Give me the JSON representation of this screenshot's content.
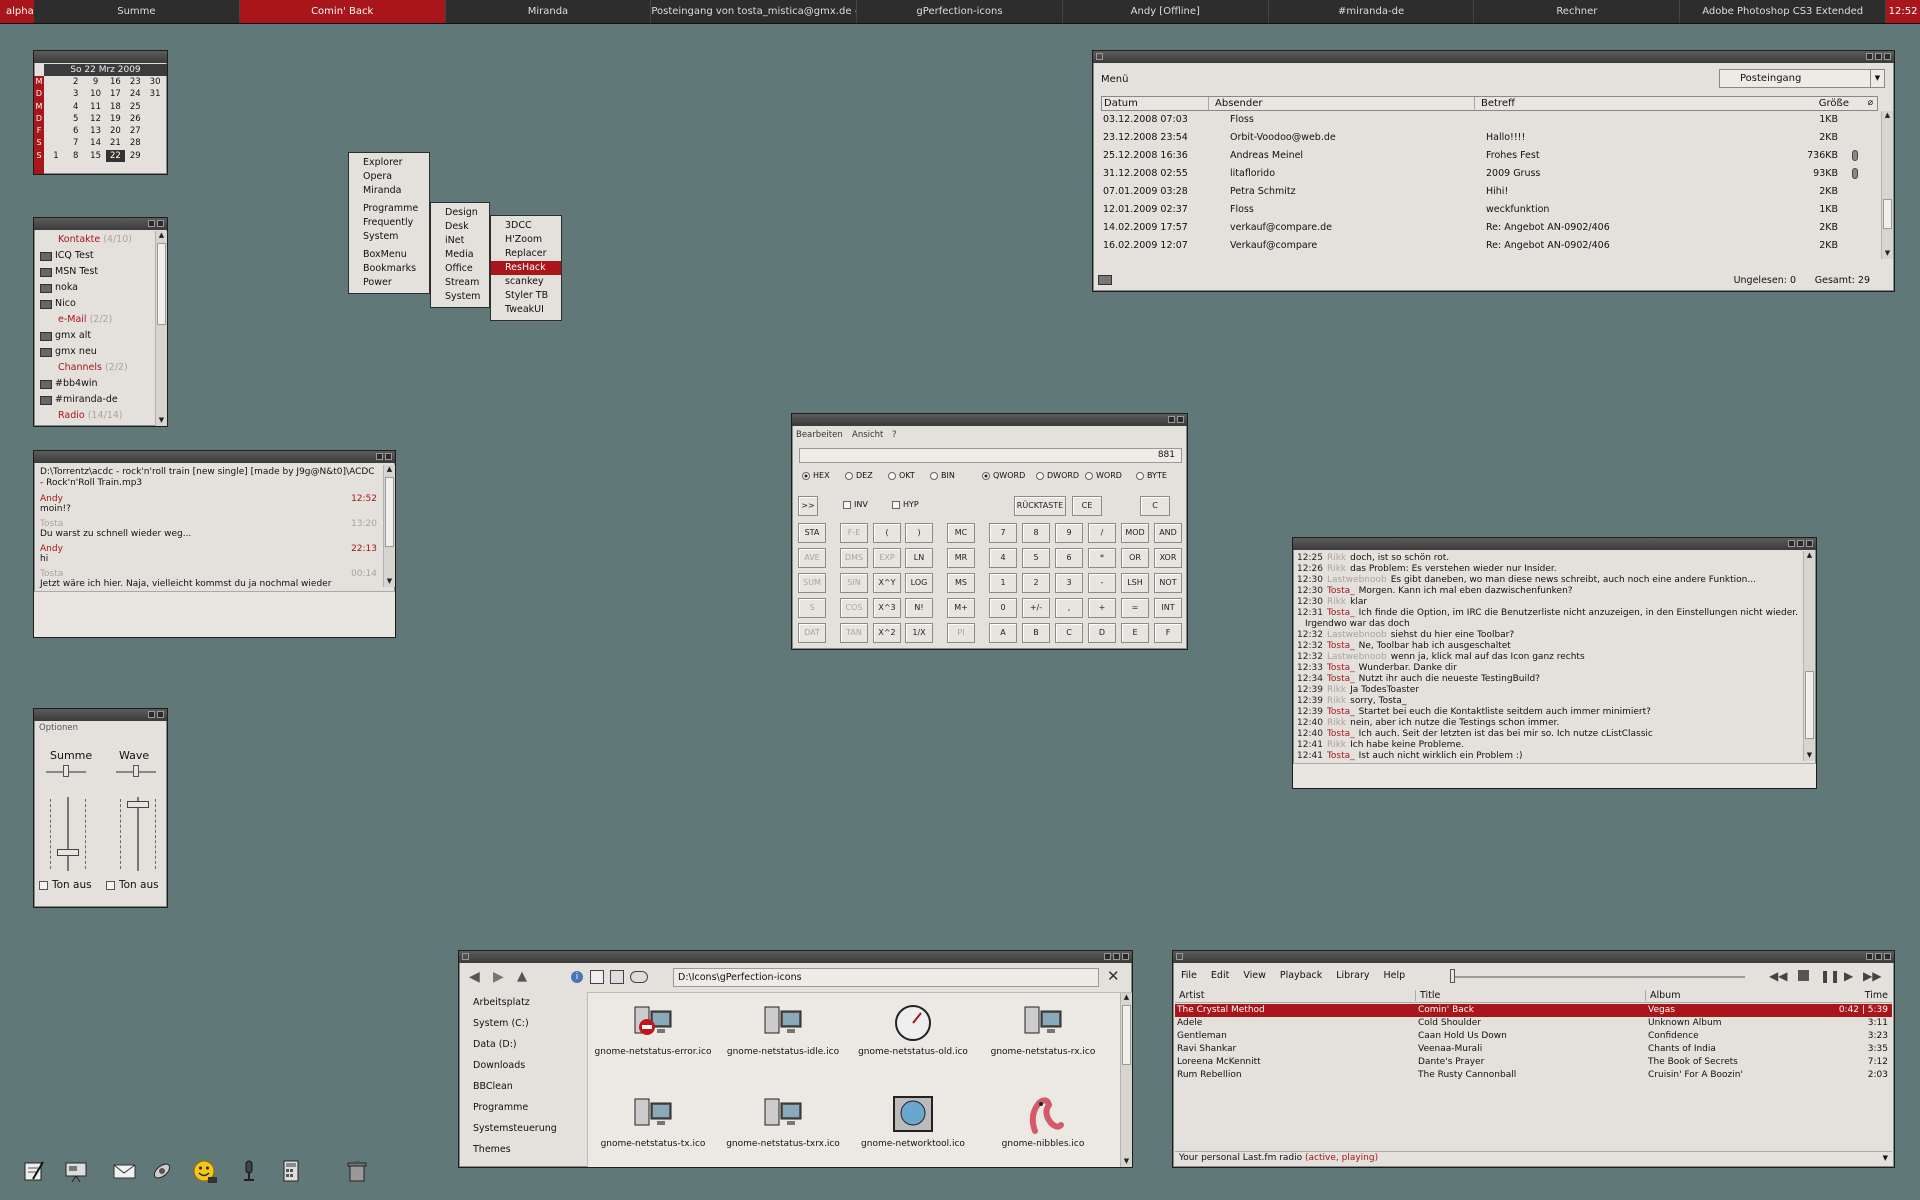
{
  "taskbar": {
    "start": "alpha",
    "tasks": [
      "Summe",
      "Comin' Back",
      "Miranda",
      "Posteingang von tosta_mistica@gmx.de - Thu...",
      "gPerfection-icons",
      "Andy [Offline]",
      "#miranda-de",
      "Rechner",
      "Adobe Photoshop CS3 Extended"
    ],
    "clock": "12:52"
  },
  "calendar": {
    "header": "So 22 Mrz 2009",
    "day_letters": [
      "M",
      "D",
      "M",
      "D",
      "F",
      "S",
      "S"
    ],
    "rows": [
      [
        "",
        "2",
        "9",
        "16",
        "23",
        "30"
      ],
      [
        "",
        "3",
        "10",
        "17",
        "24",
        "31"
      ],
      [
        "",
        "4",
        "11",
        "18",
        "25",
        ""
      ],
      [
        "",
        "5",
        "12",
        "19",
        "26",
        ""
      ],
      [
        "",
        "6",
        "13",
        "20",
        "27",
        ""
      ],
      [
        "",
        "7",
        "14",
        "21",
        "28",
        ""
      ],
      [
        "1",
        "8",
        "15",
        "22",
        "29",
        ""
      ]
    ]
  },
  "contacts": [
    {
      "type": "group",
      "label": "Kontakte",
      "count": "(4/10)"
    },
    {
      "type": "contact",
      "label": "ICQ Test"
    },
    {
      "type": "contact",
      "label": "MSN Test"
    },
    {
      "type": "contact",
      "label": "noka"
    },
    {
      "type": "contact",
      "label": "Nico"
    },
    {
      "type": "group",
      "label": "e-Mail",
      "count": "(2/2)"
    },
    {
      "type": "contact",
      "label": "gmx alt"
    },
    {
      "type": "contact",
      "label": "gmx neu"
    },
    {
      "type": "group",
      "label": "Channels",
      "count": "(2/2)"
    },
    {
      "type": "contact",
      "label": "#bb4win"
    },
    {
      "type": "contact",
      "label": "#miranda-de"
    },
    {
      "type": "group",
      "label": "Radio",
      "count": "(14/14)"
    }
  ],
  "chatlog": {
    "header": "D:\\Torrentz\\acdc - rock'n'roll train [new single] [made by J9g@N&t0]\\ACDC - Rock'n'Roll Train.mp3",
    "entries": [
      {
        "nick": "Andy",
        "time": "12:52",
        "text": "moin!?",
        "style": "red"
      },
      {
        "nick": "Tosta",
        "time": "13:20",
        "text": "Du warst zu schnell wieder weg...",
        "style": "grey"
      },
      {
        "nick": "Andy",
        "time": "22:13",
        "text": "hi",
        "style": "red"
      },
      {
        "nick": "Tosta",
        "time": "00:14",
        "text": "Jetzt wäre ich hier. Naja, vielleicht kommst du ja nochmal wieder",
        "style": "grey"
      }
    ]
  },
  "mixer": {
    "menu": "Optionen",
    "chan1": "Summe",
    "chan2": "Wave",
    "mute1": "Ton aus",
    "mute2": "Ton aus"
  },
  "menus": {
    "main_top": [
      "Explorer",
      "Opera",
      "Miranda"
    ],
    "main_bottom1": [
      "Programme",
      "Frequently",
      "System"
    ],
    "main_bottom2": [
      "BoxMenu",
      "Bookmarks",
      "Power"
    ],
    "programme": [
      "Design",
      "Desk",
      "iNet",
      "Media",
      "Office",
      "Stream",
      "System"
    ],
    "design": [
      "3DCC",
      "H'Zoom",
      "Replacer",
      "ResHack",
      "scankey",
      "Styler TB",
      "TweakUI"
    ],
    "selected": "ResHack"
  },
  "email": {
    "menu_label": "Menü",
    "folder": "Posteingang",
    "columns": {
      "date": "Datum",
      "from": "Absender",
      "subject": "Betreff",
      "size": "Größe"
    },
    "rows": [
      {
        "date": "03.12.2008 07:03",
        "from": "Floss",
        "subject": "",
        "size": "1KB",
        "attach": false
      },
      {
        "date": "23.12.2008 23:54",
        "from": "Orbit-Voodoo@web.de",
        "subject": "Hallo!!!!",
        "size": "2KB",
        "attach": false
      },
      {
        "date": "25.12.2008 16:36",
        "from": "Andreas Meinel",
        "subject": "Frohes Fest",
        "size": "736KB",
        "attach": true
      },
      {
        "date": "31.12.2008 02:55",
        "from": "litaflorido",
        "subject": "2009 Gruss",
        "size": "93KB",
        "attach": true
      },
      {
        "date": "07.01.2009 03:28",
        "from": "Petra Schmitz",
        "subject": "Hihi!",
        "size": "2KB",
        "attach": false
      },
      {
        "date": "12.01.2009 02:37",
        "from": "Floss",
        "subject": "weckfunktion",
        "size": "1KB",
        "attach": false
      },
      {
        "date": "14.02.2009 17:57",
        "from": "verkauf@compare.de",
        "subject": "Re: Angebot AN-0902/406",
        "size": "2KB",
        "attach": false
      },
      {
        "date": "16.02.2009 12:07",
        "from": "Verkauf@compare",
        "subject": "Re: Angebot AN-0902/406",
        "size": "2KB",
        "attach": false
      }
    ],
    "unread": "Ungelesen: 0",
    "total": "Gesamt: 29"
  },
  "calc": {
    "menu1": "Bearbeiten",
    "menu2": "Ansicht",
    "menu3": "?",
    "display": "881",
    "bases": [
      "HEX",
      "DEZ",
      "OKT",
      "BIN"
    ],
    "words": [
      "QWORD",
      "DWORD",
      "WORD",
      "BYTE"
    ],
    "inv": "INV",
    "hyp": "HYP",
    "back": "RÜCKTASTE",
    "ce": "CE",
    "c": "C",
    "more": ">>",
    "col1": [
      "STA",
      "AVE",
      "SUM",
      "S",
      "DAT"
    ],
    "col2": [
      "F-E",
      "DMS",
      "SIN",
      "COS",
      "TAN"
    ],
    "col3": [
      "(",
      "EXP",
      "X^Y",
      "X^3",
      "X^2"
    ],
    "col4": [
      ")",
      "LN",
      "LOG",
      "N!",
      "1/X"
    ],
    "col5": [
      "MC",
      "MR",
      "MS",
      "M+",
      "PI"
    ],
    "num": [
      [
        "7",
        "8",
        "9",
        "/",
        "MOD",
        "AND"
      ],
      [
        "4",
        "5",
        "6",
        "*",
        "OR",
        "XOR"
      ],
      [
        "1",
        "2",
        "3",
        "-",
        "LSH",
        "NOT"
      ],
      [
        "0",
        "+/-",
        ",",
        "+",
        "=",
        "INT"
      ],
      [
        "A",
        "B",
        "C",
        "D",
        "E",
        "F"
      ]
    ]
  },
  "irc": [
    {
      "t": "12:25",
      "n": "Rikk",
      "m": "doch, ist so schön rot."
    },
    {
      "t": "12:26",
      "n": "Rikk",
      "m": "das Problem: Es verstehen wieder nur Insider."
    },
    {
      "t": "12:30",
      "n": "Lastwebnoob",
      "m": "Es gibt daneben, wo man diese news schreibt, auch noch eine andere Funktion..."
    },
    {
      "t": "12:30",
      "n": "Tosta_",
      "m": "Morgen. Kann ich mal eben dazwischenfunken?"
    },
    {
      "t": "12:30",
      "n": "Rikk",
      "m": "klar"
    },
    {
      "t": "12:31",
      "n": "Tosta_",
      "m": "Ich finde die Option, im IRC die Benutzerliste nicht anzuzeigen, in den Einstellungen nicht wieder."
    },
    {
      "t": "",
      "n": "",
      "m": "Irgendwo war das doch"
    },
    {
      "t": "12:32",
      "n": "Lastwebnoob",
      "m": "siehst du hier eine Toolbar?"
    },
    {
      "t": "12:32",
      "n": "Tosta_",
      "m": "Ne, Toolbar hab ich ausgeschaltet"
    },
    {
      "t": "12:32",
      "n": "Lastwebnoob",
      "m": "wenn ja, klick mal auf das Icon ganz rechts"
    },
    {
      "t": "12:33",
      "n": "Tosta_",
      "m": "Wunderbar. Danke dir"
    },
    {
      "t": "12:34",
      "n": "Tosta_",
      "m": "Nutzt ihr auch die neueste TestingBuild?"
    },
    {
      "t": "12:39",
      "n": "Rikk",
      "m": "Ja TodesToaster"
    },
    {
      "t": "12:39",
      "n": "Rikk",
      "m": "sorry, Tosta_"
    },
    {
      "t": "12:39",
      "n": "Tosta_",
      "m": "Startet bei euch die Kontaktliste seitdem auch immer minimiert?"
    },
    {
      "t": "12:40",
      "n": "Rikk",
      "m": "nein, aber ich nutze die Testings schon immer."
    },
    {
      "t": "12:40",
      "n": "Tosta_",
      "m": "Ich auch. Seit der letzten ist das bei mir so. Ich nutze cListClassic"
    },
    {
      "t": "12:41",
      "n": "Rikk",
      "m": "Ich habe keine Probleme."
    },
    {
      "t": "12:41",
      "n": "Tosta_",
      "m": "Ist auch nicht wirklich ein Problem :)"
    }
  ],
  "filemgr": {
    "path": "D:\\Icons\\gPerfection-icons",
    "side": [
      "Arbeitsplatz",
      "System (C:)",
      "Data (D:)",
      "Downloads",
      "BBClean",
      "Programme",
      "Systemsteuerung",
      "Themes"
    ],
    "files": [
      "gnome-netstatus-error.ico",
      "gnome-netstatus-idle.ico",
      "gnome-netstatus-old.ico",
      "gnome-netstatus-rx.ico",
      "gnome-netstatus-tx.ico",
      "gnome-netstatus-txrx.ico",
      "gnome-networktool.ico",
      "gnome-nibbles.ico"
    ]
  },
  "player": {
    "menus": [
      "File",
      "Edit",
      "View",
      "Playback",
      "Library",
      "Help"
    ],
    "cols": {
      "artist": "Artist",
      "title": "Title",
      "album": "Album",
      "time": "Time"
    },
    "rows": [
      {
        "artist": "The Crystal Method",
        "title": "Comin' Back",
        "album": "Vegas",
        "time": "0:42 | 5:39"
      },
      {
        "artist": "Adele",
        "title": "Cold Shoulder",
        "album": "Unknown Album",
        "time": "3:11"
      },
      {
        "artist": "Gentleman",
        "title": "Caan Hold Us Down",
        "album": "Confidence",
        "time": "3:23"
      },
      {
        "artist": "Ravi Shankar",
        "title": "Veenaa-Murali",
        "album": "Chants of India",
        "time": "3:35"
      },
      {
        "artist": "Loreena McKennitt",
        "title": "Dante's Prayer",
        "album": "The Book of Secrets",
        "time": "7:12"
      },
      {
        "artist": "Rum Rebellion",
        "title": "The Rusty Cannonball",
        "album": "Cruisin' For A Boozin'",
        "time": "2:03"
      }
    ],
    "status": "Your personal Last.fm radio",
    "status_state": "(active, playing)"
  },
  "dock_icons": [
    "notepad-icon",
    "presentation-icon",
    "mail-icon",
    "satellite-icon",
    "smiley-icon",
    "microphone-icon",
    "calculator-icon",
    "trash-icon"
  ]
}
